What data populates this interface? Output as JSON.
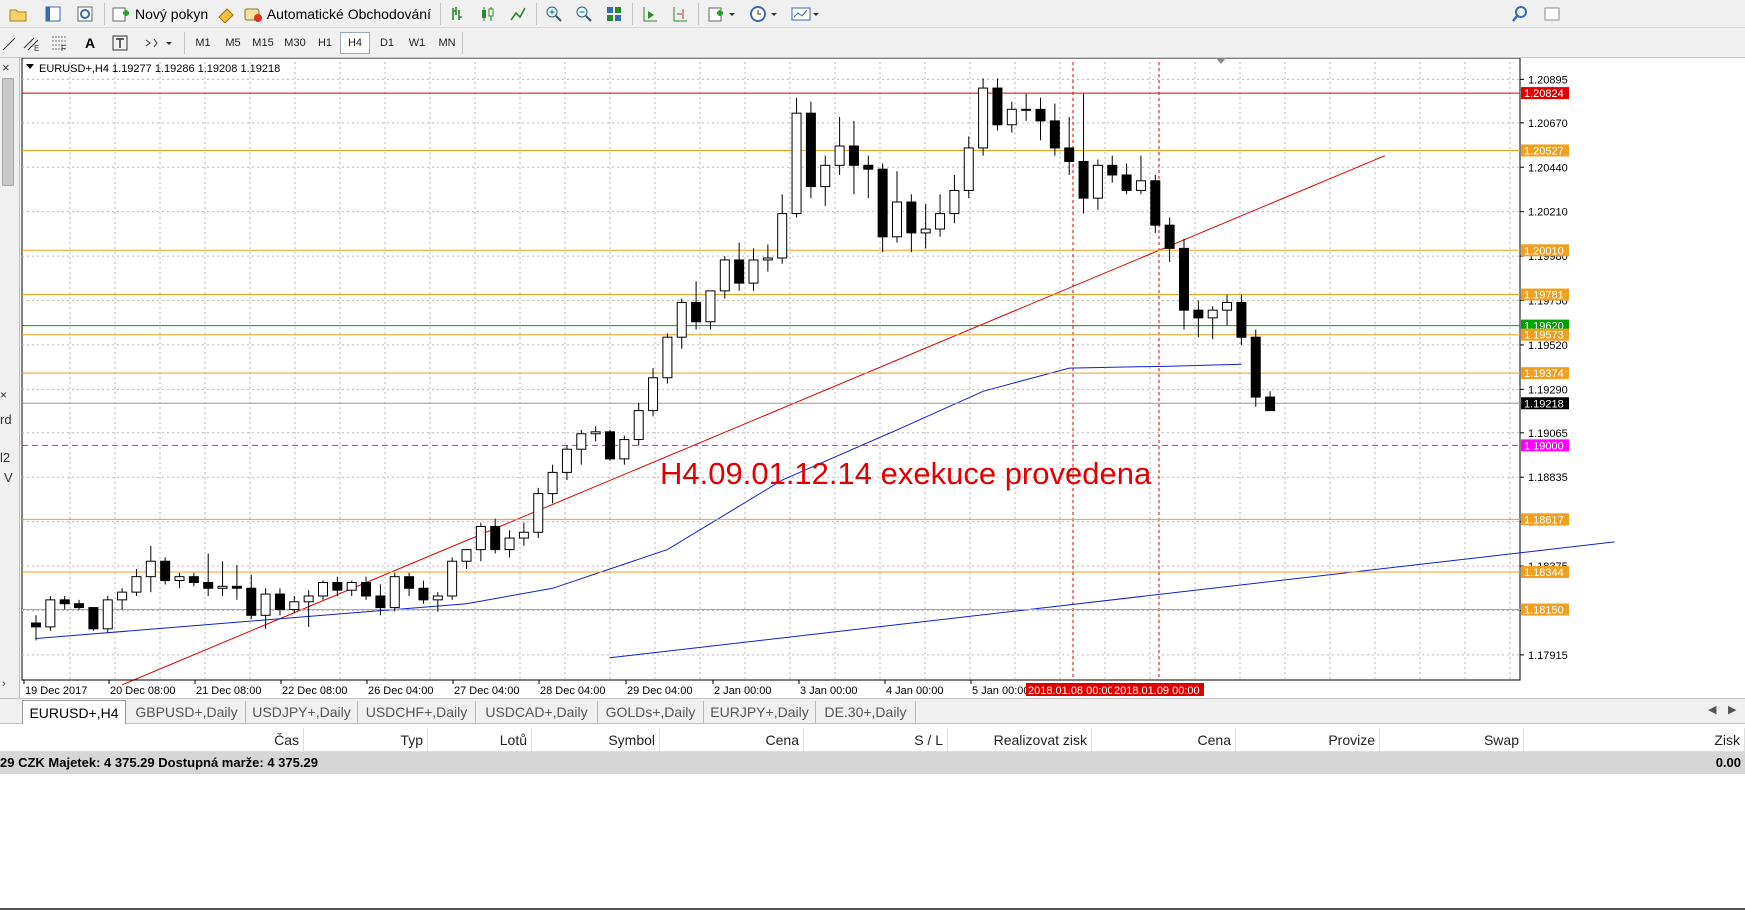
{
  "toolbar": {
    "new_order": "Nový pokyn",
    "algo": "Automatické Obchodování"
  },
  "timeframes": [
    "M1",
    "M5",
    "M15",
    "M30",
    "H1",
    "H4",
    "D1",
    "W1",
    "MN"
  ],
  "active_timeframe": "H4",
  "left_panel_fragments": [
    "rd",
    "l2",
    "V"
  ],
  "chart": {
    "symbol_label": "EURUSD+,H4",
    "ohlc": "1.19277 1.19286 1.19208 1.19218",
    "annotation": "H4.09.01.12.14  exekuce provedena",
    "date_labels": [
      "19 Dec 2017",
      "20 Dec 08:00",
      "21 Dec 08:00",
      "22 Dec 08:00",
      "26 Dec 04:00",
      "27 Dec 04:00",
      "28 Dec 04:00",
      "29 Dec 04:00",
      "2 Jan 00:00",
      "3 Jan 00:00",
      "4 Jan 00:00",
      "5 Jan 00:00"
    ],
    "marked_dates": [
      "2018.01.08 00:00",
      "2018.01.09 00:00"
    ],
    "price_ticks": [
      "1.20895",
      "1.20670",
      "1.20440",
      "1.20210",
      "1.19980",
      "1.19750",
      "1.19520",
      "1.19290",
      "1.19065",
      "1.18835",
      "1.18605",
      "1.18375",
      "1.18145",
      "1.17915"
    ],
    "levels": [
      {
        "price": "1.20824",
        "color": "#e00000",
        "kind": "line"
      },
      {
        "price": "1.20527",
        "color": "#f0a020",
        "kind": "line"
      },
      {
        "price": "1.20010",
        "color": "#f0a020",
        "kind": "line"
      },
      {
        "price": "1.19781",
        "color": "#f0a020",
        "kind": "line"
      },
      {
        "price": "1.19620",
        "color": "#00a000",
        "kind": "line"
      },
      {
        "price": "1.19573",
        "color": "#f0a020",
        "kind": "line"
      },
      {
        "price": "1.19374",
        "color": "#f0a020",
        "kind": "line"
      },
      {
        "price": "1.19218",
        "color": "#000000",
        "kind": "bid"
      },
      {
        "price": "1.19000",
        "color": "#ff00ff",
        "kind": "dash"
      },
      {
        "price": "1.18617",
        "color": "#f0a020",
        "kind": "line"
      },
      {
        "price": "1.18344",
        "color": "#f0a020",
        "kind": "line"
      },
      {
        "price": "1.18150",
        "color": "#f0a020",
        "kind": "line"
      }
    ],
    "candles": [
      [
        1.1808,
        1.1812,
        1.1799,
        1.1806
      ],
      [
        1.1806,
        1.1822,
        1.1804,
        1.182
      ],
      [
        1.182,
        1.1822,
        1.1815,
        1.1818
      ],
      [
        1.1818,
        1.182,
        1.1815,
        1.1816
      ],
      [
        1.1816,
        1.1816,
        1.1804,
        1.1805
      ],
      [
        1.1805,
        1.1822,
        1.1803,
        1.182
      ],
      [
        1.182,
        1.1826,
        1.1815,
        1.1824
      ],
      [
        1.1824,
        1.1836,
        1.1822,
        1.1832
      ],
      [
        1.1832,
        1.1848,
        1.1824,
        1.184
      ],
      [
        1.184,
        1.1842,
        1.1828,
        1.183
      ],
      [
        1.183,
        1.1834,
        1.1826,
        1.1832
      ],
      [
        1.1832,
        1.1834,
        1.1827,
        1.1829
      ],
      [
        1.1829,
        1.1844,
        1.1822,
        1.1826
      ],
      [
        1.1826,
        1.184,
        1.1822,
        1.1827
      ],
      [
        1.1827,
        1.1838,
        1.182,
        1.1826
      ],
      [
        1.1826,
        1.1833,
        1.181,
        1.1812
      ],
      [
        1.1812,
        1.1826,
        1.1805,
        1.1823
      ],
      [
        1.1823,
        1.1826,
        1.1812,
        1.1815
      ],
      [
        1.1815,
        1.1822,
        1.1813,
        1.1819
      ],
      [
        1.1819,
        1.1825,
        1.1806,
        1.1822
      ],
      [
        1.1822,
        1.183,
        1.182,
        1.1829
      ],
      [
        1.1829,
        1.1832,
        1.1822,
        1.1825
      ],
      [
        1.1825,
        1.183,
        1.1822,
        1.1829
      ],
      [
        1.1829,
        1.1832,
        1.182,
        1.1822
      ],
      [
        1.1822,
        1.1828,
        1.1812,
        1.1816
      ],
      [
        1.1816,
        1.1834,
        1.1814,
        1.1832
      ],
      [
        1.1832,
        1.1834,
        1.1822,
        1.1826
      ],
      [
        1.1826,
        1.183,
        1.1818,
        1.182
      ],
      [
        1.182,
        1.1824,
        1.1814,
        1.1822
      ],
      [
        1.1822,
        1.1842,
        1.182,
        1.184
      ],
      [
        1.184,
        1.1846,
        1.1836,
        1.1846
      ],
      [
        1.1846,
        1.186,
        1.184,
        1.1858
      ],
      [
        1.1858,
        1.1862,
        1.1844,
        1.1846
      ],
      [
        1.1846,
        1.1856,
        1.1842,
        1.1852
      ],
      [
        1.1852,
        1.186,
        1.1848,
        1.1855
      ],
      [
        1.1855,
        1.1878,
        1.1852,
        1.1875
      ],
      [
        1.1875,
        1.189,
        1.187,
        1.1886
      ],
      [
        1.1886,
        1.19,
        1.1882,
        1.1898
      ],
      [
        1.1898,
        1.1908,
        1.189,
        1.1906
      ],
      [
        1.1906,
        1.191,
        1.1902,
        1.1907
      ],
      [
        1.1907,
        1.1908,
        1.1892,
        1.1893
      ],
      [
        1.1893,
        1.1905,
        1.189,
        1.1903
      ],
      [
        1.1903,
        1.1922,
        1.19,
        1.1918
      ],
      [
        1.1918,
        1.194,
        1.1915,
        1.1935
      ],
      [
        1.1935,
        1.1958,
        1.1932,
        1.1956
      ],
      [
        1.1956,
        1.1976,
        1.195,
        1.1974
      ],
      [
        1.1974,
        1.1985,
        1.196,
        1.1964
      ],
      [
        1.1964,
        1.198,
        1.196,
        1.198
      ],
      [
        1.198,
        1.1998,
        1.1976,
        1.1996
      ],
      [
        1.1996,
        1.2005,
        1.198,
        1.1984
      ],
      [
        1.1984,
        1.2002,
        1.198,
        1.1996
      ],
      [
        1.1996,
        1.2004,
        1.199,
        1.1997
      ],
      [
        1.1997,
        1.203,
        1.1994,
        1.202
      ],
      [
        1.202,
        1.208,
        1.2018,
        1.2072
      ],
      [
        1.2072,
        1.2078,
        1.2028,
        1.2034
      ],
      [
        1.2034,
        1.205,
        1.2024,
        1.2045
      ],
      [
        1.2045,
        1.207,
        1.204,
        1.2055
      ],
      [
        1.2055,
        1.2068,
        1.203,
        1.2045
      ],
      [
        1.2045,
        1.205,
        1.2028,
        1.2043
      ],
      [
        1.2043,
        1.2046,
        1.2,
        1.2008
      ],
      [
        1.2008,
        1.2042,
        1.2005,
        1.2026
      ],
      [
        1.2026,
        1.203,
        1.2,
        1.201
      ],
      [
        1.201,
        1.2025,
        1.2002,
        1.2012
      ],
      [
        1.2012,
        1.203,
        1.2008,
        1.202
      ],
      [
        1.202,
        1.204,
        1.2015,
        1.2032
      ],
      [
        1.2032,
        1.206,
        1.2028,
        1.2054
      ],
      [
        1.2054,
        1.209,
        1.205,
        1.2085
      ],
      [
        1.2085,
        1.209,
        1.2063,
        1.2066
      ],
      [
        1.2066,
        1.2078,
        1.2062,
        1.2074
      ],
      [
        1.2074,
        1.2082,
        1.2068,
        1.2074
      ],
      [
        1.2074,
        1.208,
        1.2058,
        1.2068
      ],
      [
        1.2068,
        1.2077,
        1.205,
        1.2054
      ],
      [
        1.2054,
        1.207,
        1.204,
        1.2047
      ],
      [
        1.2047,
        1.2082,
        1.202,
        1.2028
      ],
      [
        1.2028,
        1.2048,
        1.2022,
        1.2045
      ],
      [
        1.2045,
        1.205,
        1.2036,
        1.204
      ],
      [
        1.204,
        1.2046,
        1.203,
        1.2032
      ],
      [
        1.2032,
        1.205,
        1.203,
        1.2037
      ],
      [
        1.2037,
        1.204,
        1.201,
        1.2014
      ],
      [
        1.2014,
        1.2018,
        1.1995,
        1.2002
      ],
      [
        1.2002,
        1.2007,
        1.196,
        1.197
      ],
      [
        1.197,
        1.1975,
        1.1956,
        1.1966
      ],
      [
        1.1966,
        1.1972,
        1.1955,
        1.197
      ],
      [
        1.197,
        1.1978,
        1.1962,
        1.1974
      ],
      [
        1.1974,
        1.1978,
        1.1952,
        1.1956
      ],
      [
        1.1956,
        1.196,
        1.192,
        1.1925
      ],
      [
        1.1925,
        1.1928,
        1.1918,
        1.1918
      ]
    ],
    "ma_points": [
      [
        0,
        1.18
      ],
      [
        10,
        1.1806
      ],
      [
        20,
        1.1812
      ],
      [
        30,
        1.1818
      ],
      [
        36,
        1.1826
      ],
      [
        44,
        1.1846
      ],
      [
        52,
        1.1882
      ],
      [
        60,
        1.1908
      ],
      [
        66,
        1.1928
      ],
      [
        72,
        1.194
      ],
      [
        79,
        1.1941
      ],
      [
        84,
        1.1942
      ]
    ],
    "trendline_red": [
      [
        6,
        1.1776
      ],
      [
        94,
        1.205
      ]
    ],
    "trendline_blue": [
      [
        40,
        1.179
      ],
      [
        110,
        1.185
      ]
    ]
  },
  "tabs": [
    "EURUSD+,H4",
    "GBPUSD+,Daily",
    "USDJPY+,Daily",
    "USDCHF+,Daily",
    "USDCAD+,Daily",
    "GOLDs+,Daily",
    "EURJPY+,Daily",
    "DE.30+,Daily"
  ],
  "active_tab": "EURUSD+,H4",
  "table_headers": [
    "Čas",
    "Typ",
    "Lotů",
    "Symbol",
    "Cena",
    "S / L",
    "Realizovat zisk",
    "Cena",
    "Provize",
    "Swap",
    "Zisk"
  ],
  "balance": {
    "text": "29 CZK  Majetek: 4 375.29  Dostupná marže: 4 375.29",
    "right": "0.00"
  }
}
